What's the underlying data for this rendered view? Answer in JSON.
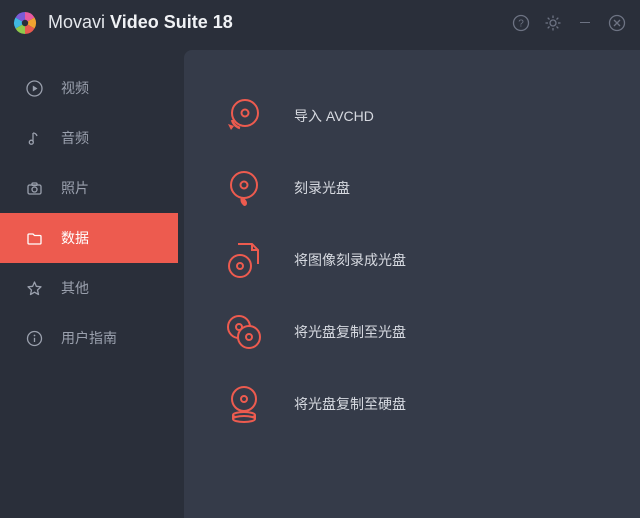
{
  "colors": {
    "accent": "#ed5b4f",
    "bg": "#2a2f3a",
    "panel": "#353b49"
  },
  "titlebar": {
    "brand_light": "Movavi ",
    "brand_bold": "Video Suite 18"
  },
  "sidebar": {
    "items": [
      {
        "label": "视频",
        "icon": "play-icon"
      },
      {
        "label": "音频",
        "icon": "music-note-icon"
      },
      {
        "label": "照片",
        "icon": "camera-icon"
      },
      {
        "label": "数据",
        "icon": "folder-icon"
      },
      {
        "label": "其他",
        "icon": "star-icon"
      },
      {
        "label": "用户指南",
        "icon": "info-icon"
      }
    ],
    "active_index": 3
  },
  "main": {
    "actions": [
      {
        "label": "导入 AVCHD",
        "icon": "import-avchd-icon"
      },
      {
        "label": "刻录光盘",
        "icon": "burn-disc-icon"
      },
      {
        "label": "将图像刻录成光盘",
        "icon": "image-to-disc-icon"
      },
      {
        "label": "将光盘复制至光盘",
        "icon": "disc-to-disc-icon"
      },
      {
        "label": "将光盘复制至硬盘",
        "icon": "disc-to-hdd-icon"
      }
    ]
  }
}
